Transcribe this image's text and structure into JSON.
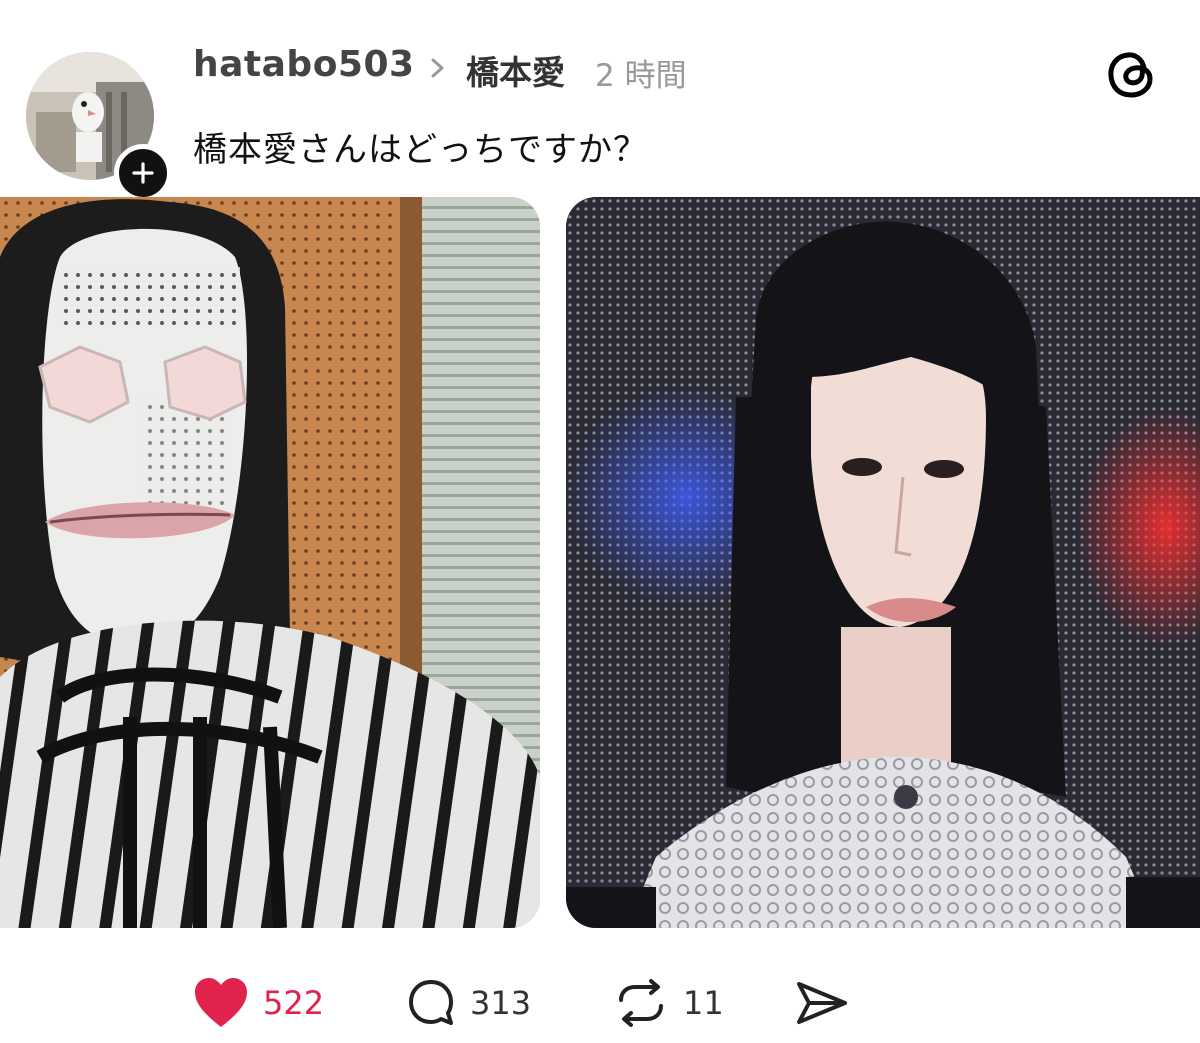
{
  "post": {
    "username": "hatabo503",
    "topic": "橋本愛",
    "time": "2 時間",
    "text": "橋本愛さんはどっちですか？",
    "images": [
      {
        "alt": "left-image",
        "icon": "monster-photo"
      },
      {
        "alt": "right-image",
        "icon": "woman-photo"
      }
    ]
  },
  "actions": {
    "likes": "522",
    "replies": "313",
    "reposts": "11"
  },
  "colors": {
    "like": "#e0224c",
    "text": "#111111",
    "muted": "#999999",
    "badge": "#111111"
  },
  "icons": {
    "logo": "threads-logo-icon",
    "chevron": "chevron-right-icon",
    "like": "heart-icon",
    "reply": "comment-icon",
    "repost": "repost-icon",
    "share": "send-icon"
  }
}
